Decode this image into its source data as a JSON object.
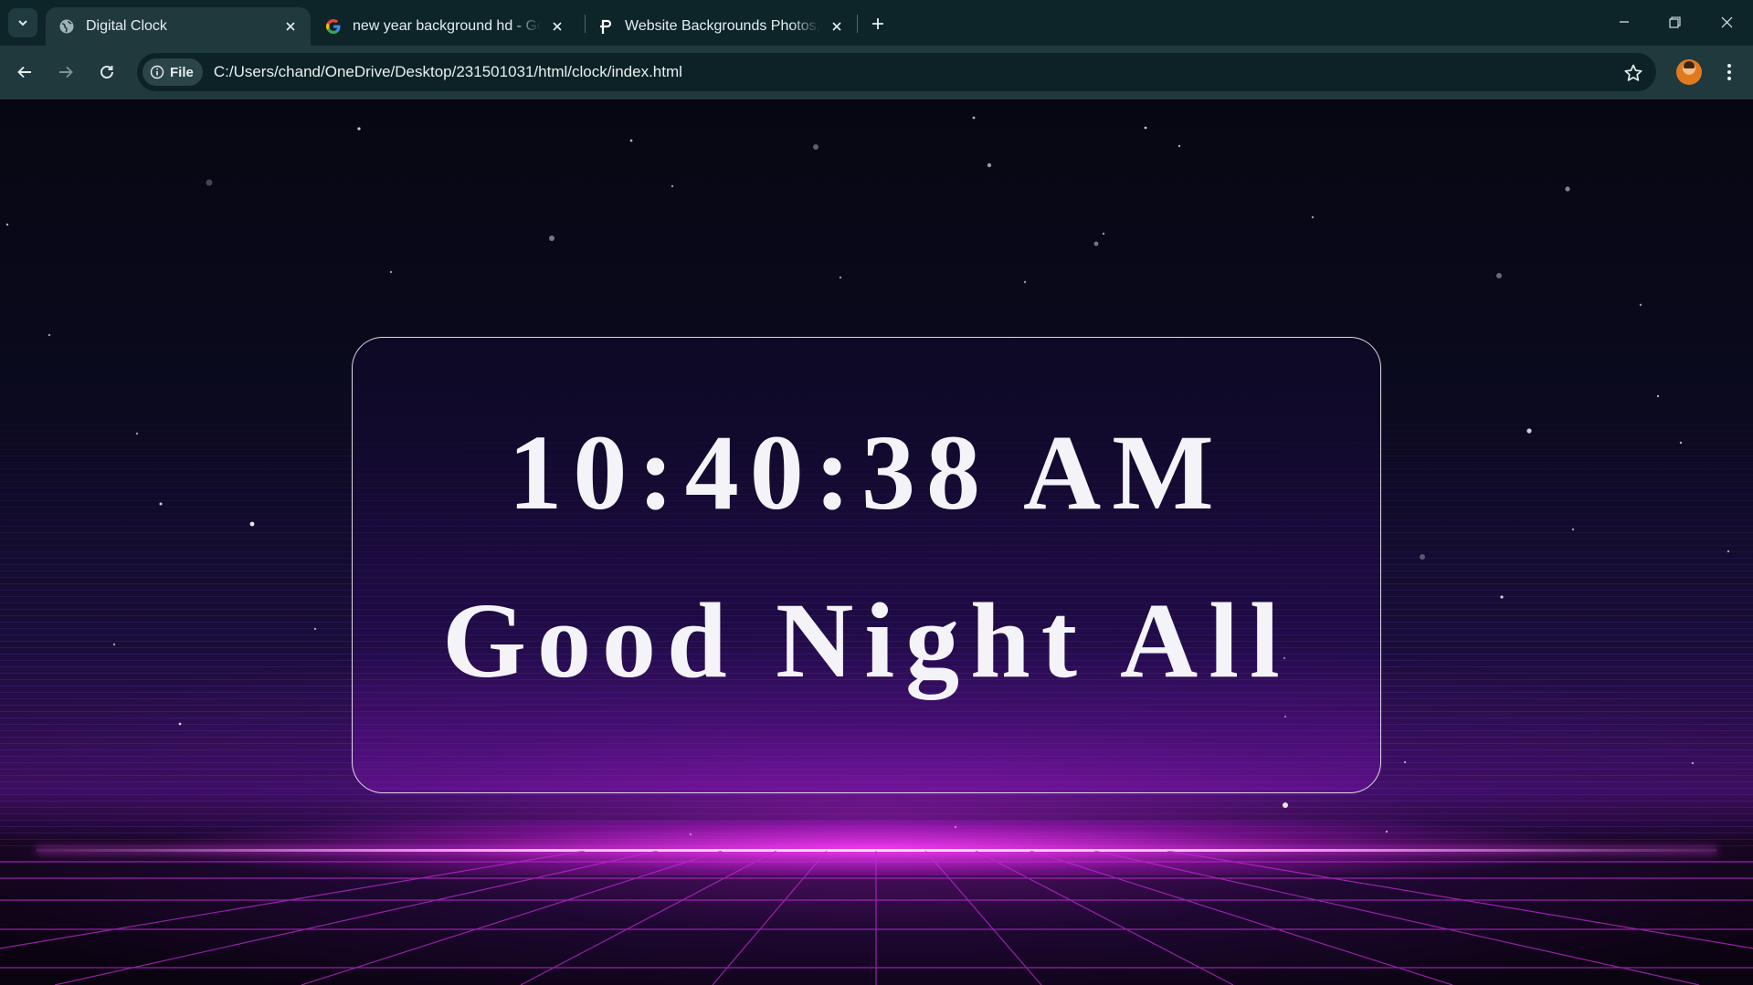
{
  "browser": {
    "tabs": [
      {
        "title": "Digital Clock",
        "favicon": "globe-icon",
        "active": true
      },
      {
        "title": "new year background hd - Goo",
        "favicon": "google-icon",
        "active": false
      },
      {
        "title": "Website Backgrounds Photos, D",
        "favicon": "pexels-icon",
        "active": false
      }
    ],
    "address": {
      "chip_label": "File",
      "url": "C:/Users/chand/OneDrive/Desktop/231501031/html/clock/index.html"
    }
  },
  "page": {
    "time": "10:40:38 AM",
    "greeting": "Good Night All"
  },
  "colors": {
    "chrome_bg": "#20393d",
    "tabstrip_bg": "#0d2529",
    "neon": "#ff40ff",
    "text": "#f4f4f8"
  }
}
